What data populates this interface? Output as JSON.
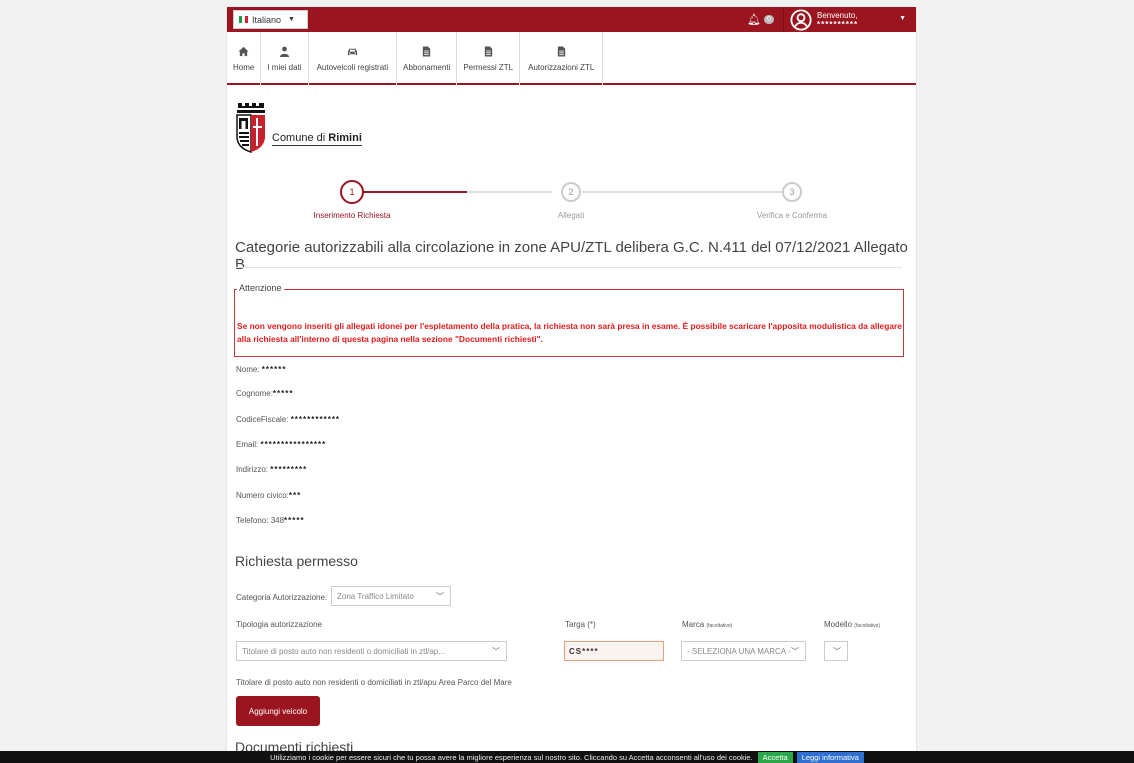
{
  "topbar": {
    "language": "Italiano",
    "notifications_count": "0",
    "welcome": "Benvenuto,",
    "user_name": "**********"
  },
  "nav": [
    {
      "label": "Home",
      "icon": "home-icon"
    },
    {
      "label": "I miei dati",
      "icon": "user-icon"
    },
    {
      "label": "Autoveicoli registrati",
      "icon": "car-icon"
    },
    {
      "label": "Abbonamenti",
      "icon": "document-icon"
    },
    {
      "label": "Permessi ZTL",
      "icon": "document-icon"
    },
    {
      "label": "Autorizzazioni ZTL",
      "icon": "document-icon"
    }
  ],
  "logo": {
    "prefix": "Comune di ",
    "city": "Rimini"
  },
  "steps": [
    {
      "number": "1",
      "label": "Inserimento Richiesta"
    },
    {
      "number": "2",
      "label": "Allegati"
    },
    {
      "number": "3",
      "label": "Verifica e Conferma"
    }
  ],
  "heading": "Categorie autorizzabili alla circolazione in zone APU/ZTL delibera G.C. N.411 del 07/12/2021 Allegato B",
  "alert": {
    "legend": "Attenzione",
    "text": "Se non vengono inseriti gli allegati idonei per l'espletamento della pratica, la richiesta non sarà presa in esame. È possibile scaricare l'apposita modulistica da allegare alla richiesta all'interno di questa pagina nella sezione \"Documenti richiesti\"."
  },
  "personal": [
    {
      "label": "Nome: ",
      "value": "******"
    },
    {
      "label": "Cognome:",
      "value": "*****"
    },
    {
      "label": "CodiceFiscale: ",
      "value": "************"
    },
    {
      "label": "Email: ",
      "value": "****************"
    },
    {
      "label": "Indirizzo: ",
      "value": "*********"
    },
    {
      "label": "Numero civico:",
      "value": "***"
    },
    {
      "label": "Telefono: 348",
      "value": "*****"
    }
  ],
  "request": {
    "title": "Richiesta permesso",
    "category_label": "Categoria Autorizzazione:",
    "category_value": "Zona Traffico Limitato",
    "type_label": "Tipologia autorizzazione",
    "type_value": "Titolare di posto auto non residenti o domiciliati in ztl/ap...",
    "plate_label": "Targa (*)",
    "plate_value": "CS****",
    "brand_label": "Marca",
    "brand_optional": "(facoltativo)",
    "brand_value": "- SELEZIONA UNA MARCA -",
    "model_label": "Modello",
    "model_optional": "(facoltativo)",
    "type_description": "Titolare di posto auto non residenti o domiciliati in ztl/apu Area Parco del Mare",
    "add_button": "Aggiungi veicolo"
  },
  "docs_title": "Documenti richiesti",
  "cookie": {
    "text": "Utilizziamo i cookie per essere sicuri che tu possa avere la migliore esperienza sul nostro sito. Cliccando su Accetta acconsenti all'uso dei cookie.",
    "accept": "Accetta",
    "more": "Leggi informativa"
  },
  "colors": {
    "brand": "#9b1520",
    "alert": "#e01b1b"
  }
}
